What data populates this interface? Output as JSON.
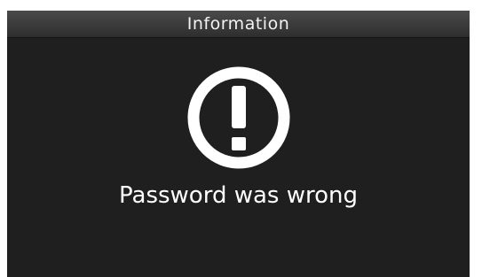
{
  "dialog": {
    "title": "Information",
    "icon": "exclamation-circle-icon",
    "message": "Password was wrong"
  },
  "colors": {
    "background": "#1f1f1f",
    "titlebar_top": "#4a4a4a",
    "titlebar_bottom": "#2e2e2e",
    "text": "#ffffff"
  }
}
